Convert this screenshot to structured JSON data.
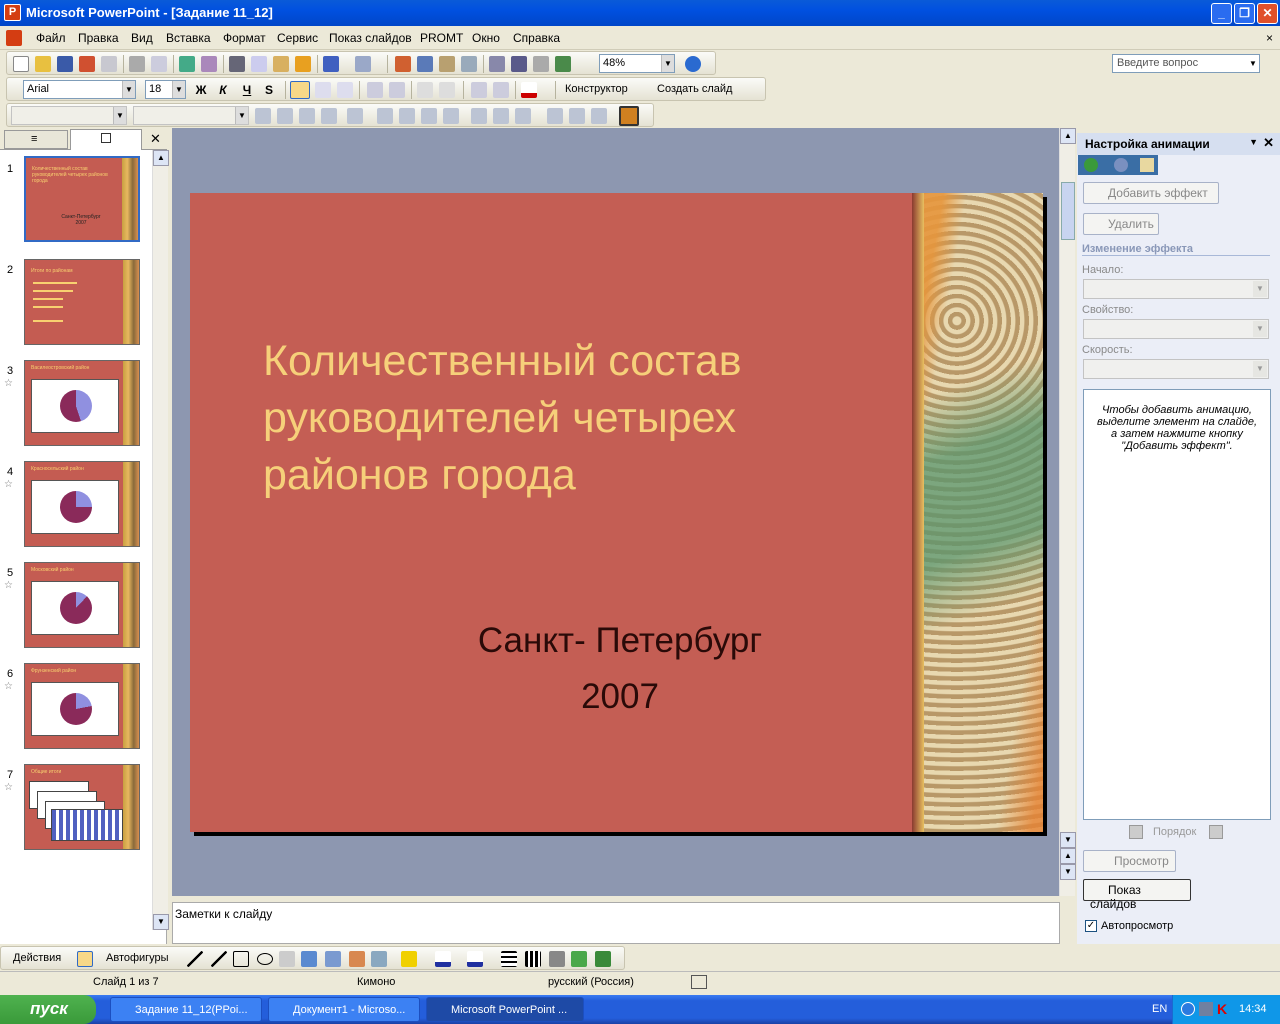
{
  "window": {
    "title": "Microsoft PowerPoint - [Задание 11_12]",
    "minimize": "_",
    "restore": "❐",
    "close": "✕"
  },
  "menu": {
    "items": [
      "Файл",
      "Правка",
      "Вид",
      "Вставка",
      "Формат",
      "Сервис",
      "Показ слайдов",
      "PROMT",
      "Окно",
      "Справка"
    ],
    "ask_placeholder": "Введите вопрос"
  },
  "toolbar": {
    "zoom": "48%",
    "font": "Arial",
    "size": "18",
    "bold": "Ж",
    "italic": "К",
    "underline": "Ч",
    "shadow": "S",
    "designer": "Конструктор",
    "new_slide": "Создать слайд"
  },
  "panel": {
    "close": "✕"
  },
  "slides": [
    {
      "num": "1",
      "title": "Количественный состав руководителей четырех районов города",
      "sub": "Санкт-Петербург 2007"
    },
    {
      "num": "2",
      "title": "Итоги по районам"
    },
    {
      "num": "3",
      "title": "Василеостровский район"
    },
    {
      "num": "4",
      "title": "Красносельский район"
    },
    {
      "num": "5",
      "title": "Московский район"
    },
    {
      "num": "6",
      "title": "Фрунзенский район"
    },
    {
      "num": "7",
      "title": "Общие итоги"
    }
  ],
  "slide": {
    "title": "Количественный состав руководителей четырех районов города",
    "city": "Санкт- Петербург",
    "year": "2007"
  },
  "notes": {
    "placeholder": "Заметки к слайду"
  },
  "taskpane": {
    "title": "Настройка анимации",
    "add_effect": "Добавить эффект",
    "remove": "Удалить",
    "change_effect": "Изменение эффекта",
    "start": "Начало:",
    "property": "Свойство:",
    "speed": "Скорость:",
    "hint": "Чтобы добавить анимацию, выделите элемент на слайде, а затем нажмите кнопку \"Добавить эффект\".",
    "order": "Порядок",
    "preview": "Просмотр",
    "slideshow": "Показ слайдов",
    "autopreview": "Автопросмотр"
  },
  "drawing": {
    "actions": "Действия",
    "autoshapes": "Автофигуры"
  },
  "status": {
    "slide": "Слайд 1 из 7",
    "design": "Кимоно",
    "language": "русский (Россия)"
  },
  "taskbar": {
    "start": "пуск",
    "tasks": [
      "Задание 11_12(PPoi...",
      "Документ1 - Microso...",
      "Microsoft PowerPoint ..."
    ],
    "lang": "EN",
    "time": "14:34"
  }
}
